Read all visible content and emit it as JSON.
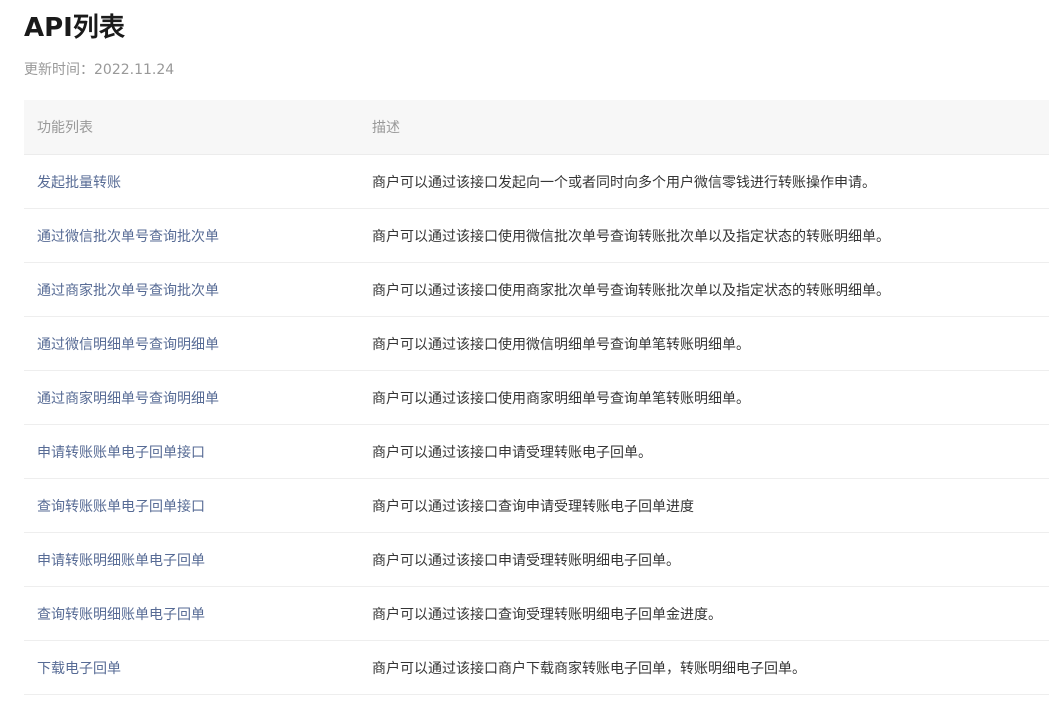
{
  "header": {
    "title": "API列表",
    "updated": "更新时间：2022.11.24"
  },
  "table": {
    "columns": [
      "功能列表",
      "描述"
    ],
    "rows": [
      {
        "func": "发起批量转账",
        "desc": "商户可以通过该接口发起向一个或者同时向多个用户微信零钱进行转账操作申请。"
      },
      {
        "func": "通过微信批次单号查询批次单",
        "desc": "商户可以通过该接口使用微信批次单号查询转账批次单以及指定状态的转账明细单。"
      },
      {
        "func": "通过商家批次单号查询批次单",
        "desc": "商户可以通过该接口使用商家批次单号查询转账批次单以及指定状态的转账明细单。"
      },
      {
        "func": "通过微信明细单号查询明细单",
        "desc": "商户可以通过该接口使用微信明细单号查询单笔转账明细单。"
      },
      {
        "func": "通过商家明细单号查询明细单",
        "desc": "商户可以通过该接口使用商家明细单号查询单笔转账明细单。"
      },
      {
        "func": "申请转账账单电子回单接口",
        "desc": "商户可以通过该接口申请受理转账电子回单。"
      },
      {
        "func": "查询转账账单电子回单接口",
        "desc": "商户可以通过该接口查询申请受理转账电子回单进度"
      },
      {
        "func": "申请转账明细账单电子回单",
        "desc": "商户可以通过该接口申请受理转账明细电子回单。"
      },
      {
        "func": "查询转账明细账单电子回单",
        "desc": "商户可以通过该接口查询受理转账明细电子回单金进度。"
      },
      {
        "func": "下载电子回单",
        "desc": "商户可以通过该接口商户下载商家转账电子回单，转账明细电子回单。"
      }
    ]
  }
}
